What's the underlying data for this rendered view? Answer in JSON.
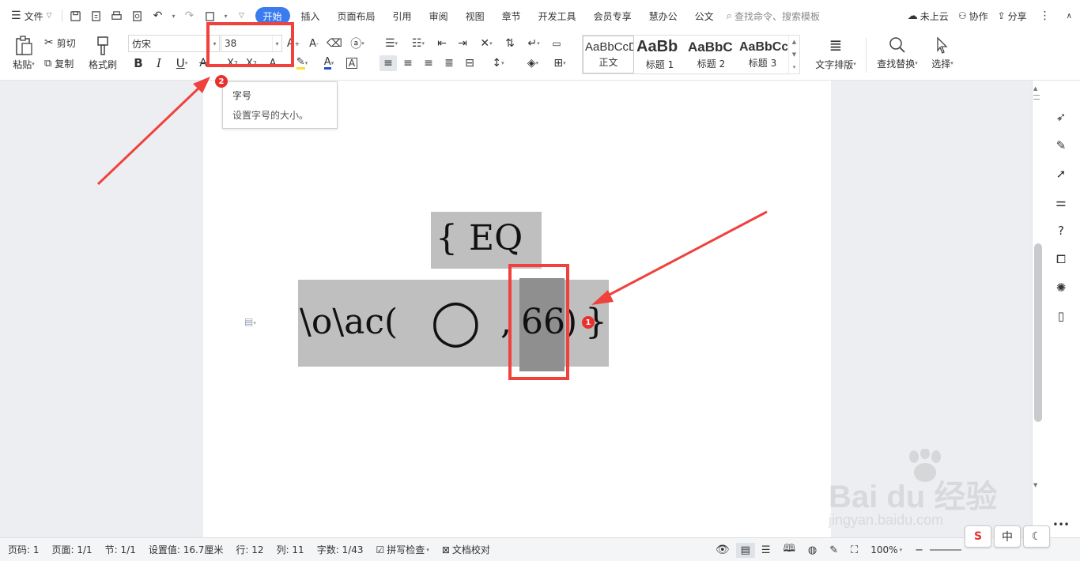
{
  "menu": {
    "file": "文件",
    "tabs": [
      "开始",
      "插入",
      "页面布局",
      "引用",
      "审阅",
      "视图",
      "章节",
      "开发工具",
      "会员专享",
      "慧办公",
      "公文"
    ],
    "search_placeholder": "查找命令、搜索模板",
    "cloud": "未上云",
    "collab": "协作",
    "share": "分享"
  },
  "ribbon": {
    "paste": "粘贴",
    "cut": "剪切",
    "copy": "复制",
    "format_painter": "格式刷",
    "font_name": "仿宋",
    "font_size": "38",
    "styles": [
      {
        "sample": "AaBbCcDd",
        "name": "正文"
      },
      {
        "sample": "AaBb",
        "name": "标题 1"
      },
      {
        "sample": "AaBbC",
        "name": "标题 2"
      },
      {
        "sample": "AaBbCc",
        "name": "标题 3"
      }
    ],
    "text_layout": "文字排版",
    "find_replace": "查找替换",
    "select": "选择"
  },
  "tooltip": {
    "title": "字号",
    "desc": "设置字号的大小。"
  },
  "document": {
    "field_open": "{ EQ",
    "field_code_a": "\\o\\ac(",
    "circle": "◯",
    "comma": ",",
    "selected_text": "66",
    "close_paren": ")",
    "field_close": "}"
  },
  "annotations": {
    "badge1": "1",
    "badge2": "2"
  },
  "status": {
    "page_num": "页码: 1",
    "page": "页面: 1/1",
    "section": "节: 1/1",
    "setting": "设置值: 16.7厘米",
    "row": "行: 12",
    "col": "列: 11",
    "word_count": "字数: 1/43",
    "spell_check": "拼写检查",
    "doc_check": "文档校对",
    "zoom": "100%"
  },
  "ime": {
    "logo": "S",
    "mode": "中",
    "moon": "☾"
  },
  "watermark": {
    "brand": "Bai du 经验",
    "url": "jingyan.baidu.com"
  },
  "colors": {
    "accent": "#3a7bf0",
    "annotation_red": "#f0413c",
    "selection": "#bfbfbf"
  }
}
